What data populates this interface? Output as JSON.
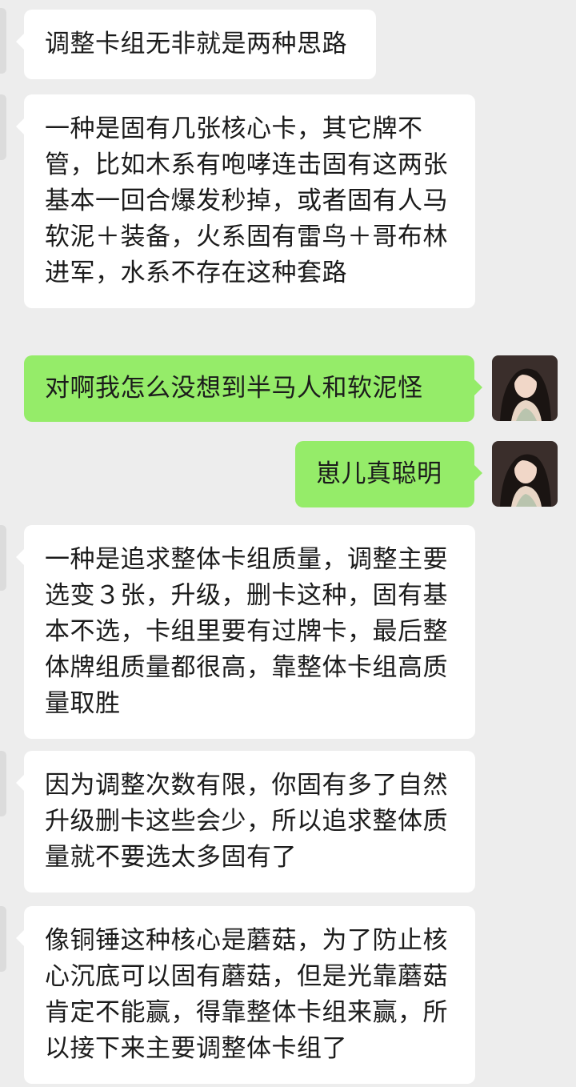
{
  "messages": [
    {
      "side": "in",
      "text": "调整卡组无非就是两种思路"
    },
    {
      "side": "in",
      "text": "一种是固有几张核心卡，其它牌不管，比如木系有咆哮连击固有这两张基本一回合爆发秒掉，或者固有人马软泥＋装备，火系固有雷鸟＋哥布林进军，水系不存在这种套路"
    },
    {
      "side": "out",
      "text": "对啊我怎么没想到半马人和软泥怪",
      "avatar": "user-avatar"
    },
    {
      "side": "out",
      "text": "崽儿真聪明",
      "avatar": "user-avatar"
    },
    {
      "side": "in",
      "text": "一种是追求整体卡组质量，调整主要选变３张，升级，删卡这种，固有基本不选，卡组里要有过牌卡，最后整体牌组质量都很高，靠整体卡组高质量取胜"
    },
    {
      "side": "in",
      "text": "因为调整次数有限，你固有多了自然升级删卡这些会少，所以追求整体质量就不要选太多固有了"
    },
    {
      "side": "in",
      "text": "像铜锤这种核心是蘑菇，为了防止核心沉底可以固有蘑菇，但是光靠蘑菇肯定不能赢，得靠整体卡组来赢，所以接下来主要调整体卡组了"
    }
  ],
  "colors": {
    "background": "#ededed",
    "incoming_bubble": "#ffffff",
    "outgoing_bubble": "#95ec69",
    "text": "#1b1b1b"
  }
}
